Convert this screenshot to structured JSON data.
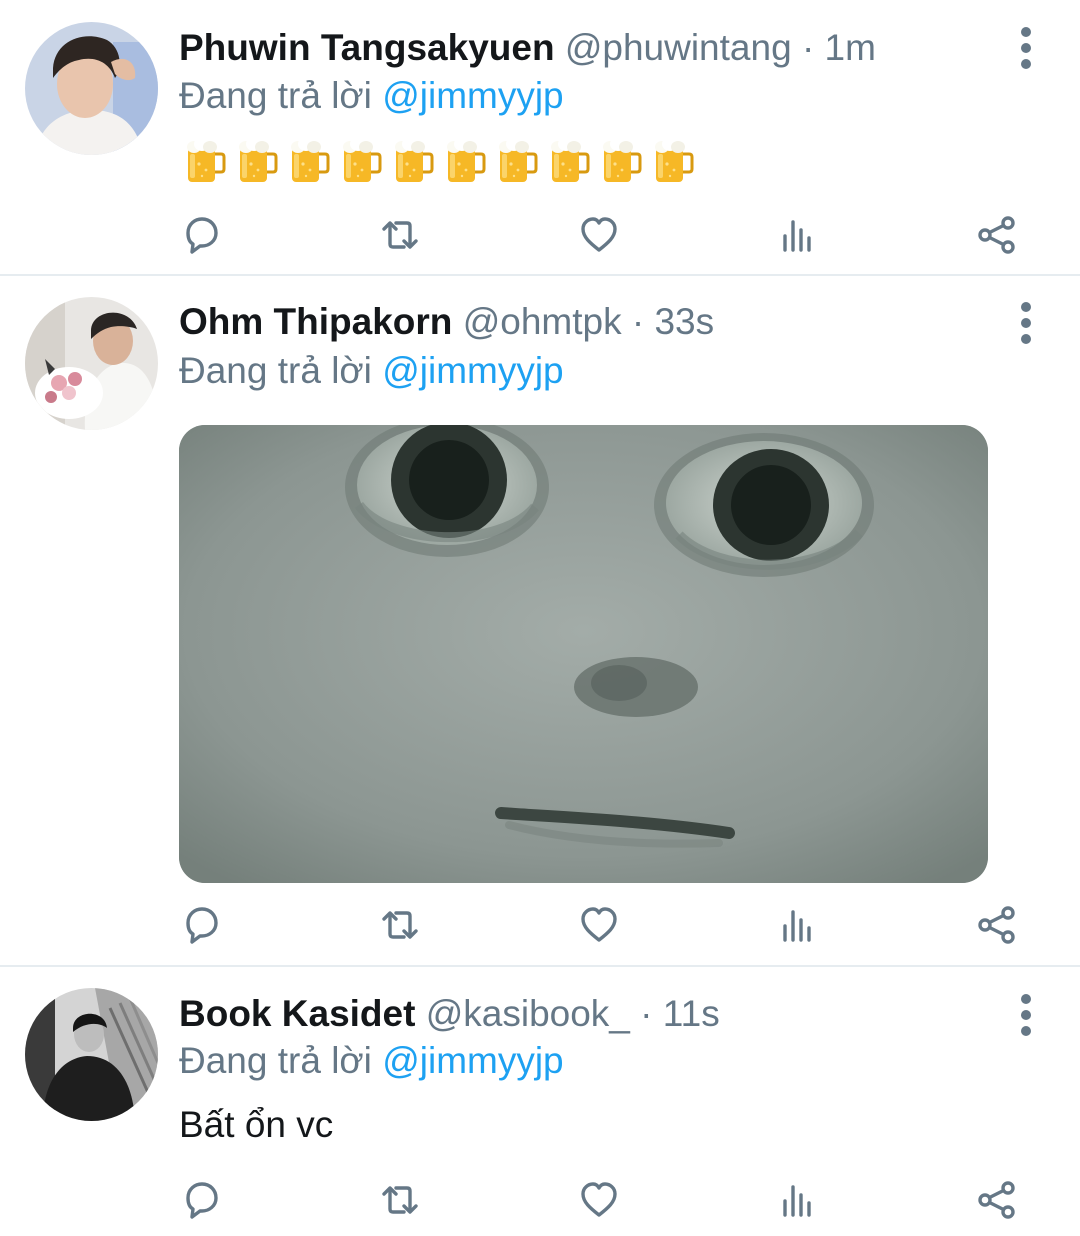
{
  "tweets": [
    {
      "name": "Phuwin Tangsakyuen",
      "handle": "@phuwintang",
      "separator": "·",
      "time": "1m",
      "reply_prefix": "Đang trả lời",
      "reply_to": "@jimmyyjp",
      "emoji_content": "🍺🍺🍺🍺🍺🍺🍺🍺🍺🍺",
      "emoji_icon": "beer-mug-icon",
      "media": null
    },
    {
      "name": "Ohm Thipakorn",
      "handle": "@ohmtpk",
      "separator": "·",
      "time": "33s",
      "reply_prefix": "Đang trả lời",
      "reply_to": "@jimmyyjp",
      "media": "meme-face-image"
    },
    {
      "name": "Book Kasidet",
      "handle": "@kasibook_",
      "separator": "·",
      "time": "11s",
      "reply_prefix": "Đang trả lời",
      "reply_to": "@jimmyyjp",
      "text": "Bất ổn vc",
      "media": null
    }
  ],
  "action_icons": [
    "reply-icon",
    "retweet-icon",
    "like-icon",
    "analytics-icon",
    "share-icon"
  ],
  "colors": {
    "accent": "#1da1f2",
    "secondary_text": "#657786",
    "primary_text": "#14171a",
    "divider": "#e6ecf0"
  }
}
